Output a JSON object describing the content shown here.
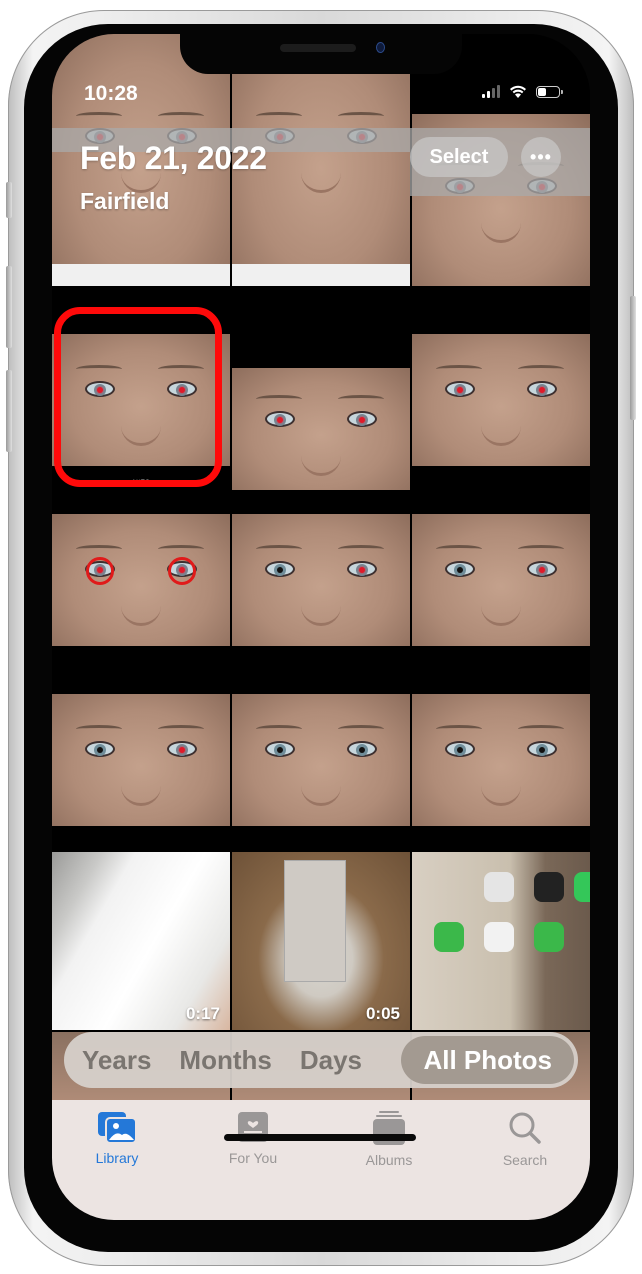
{
  "status_bar": {
    "time": "10:28",
    "signal_bars_active": 2,
    "signal_bars_total": 4,
    "wifi": "wifi-icon",
    "battery_level": 0.35
  },
  "header": {
    "date": "Feb 21, 2022",
    "location": "Fairfield",
    "select_label": "Select",
    "more_label": "•••"
  },
  "photos": [
    {
      "id": "top-1",
      "kind": "face",
      "red_eyes": [
        "left",
        "right"
      ]
    },
    {
      "id": "top-2",
      "kind": "face",
      "red_eyes": [
        "left",
        "right"
      ]
    },
    {
      "id": "top-3",
      "kind": "face",
      "red_eyes": [
        "left",
        "right"
      ]
    },
    {
      "id": "row2-1",
      "kind": "face",
      "red_eyes": [
        "left",
        "right"
      ],
      "badge": "AUTO",
      "highlighted": true
    },
    {
      "id": "row2-2",
      "kind": "face",
      "red_eyes": [
        "left",
        "right"
      ]
    },
    {
      "id": "row2-3",
      "kind": "face",
      "red_eyes": [
        "left",
        "right"
      ]
    },
    {
      "id": "row3-1",
      "kind": "face",
      "red_eyes": [
        "left",
        "right"
      ],
      "circled": true
    },
    {
      "id": "row3-2",
      "kind": "face",
      "red_eyes": [
        "right"
      ]
    },
    {
      "id": "row3-3",
      "kind": "face",
      "red_eyes": [
        "right"
      ]
    },
    {
      "id": "row4-1",
      "kind": "face",
      "red_eyes": [
        "right"
      ]
    },
    {
      "id": "row4-2",
      "kind": "face",
      "red_eyes": []
    },
    {
      "id": "row4-3",
      "kind": "face",
      "red_eyes": []
    },
    {
      "id": "row5-1",
      "kind": "video",
      "description": "white bucket lid",
      "duration": "0:17"
    },
    {
      "id": "row5-2",
      "kind": "video",
      "description": "cinder blocks on grass",
      "duration": "0:05"
    },
    {
      "id": "row5-3",
      "kind": "screenshot",
      "description": "home screen with apps"
    }
  ],
  "view_switcher": {
    "items": [
      {
        "label": "Years",
        "active": false
      },
      {
        "label": "Months",
        "active": false
      },
      {
        "label": "Days",
        "active": false
      },
      {
        "label": "All Photos",
        "active": true
      }
    ]
  },
  "tab_bar": {
    "items": [
      {
        "label": "Library",
        "icon": "library-icon",
        "active": true
      },
      {
        "label": "For You",
        "icon": "for-you-icon",
        "active": false
      },
      {
        "label": "Albums",
        "icon": "albums-icon",
        "active": false
      },
      {
        "label": "Search",
        "icon": "search-icon",
        "active": false
      }
    ]
  },
  "colors": {
    "accent": "#2478d8",
    "highlight_box": "#ff0a0a",
    "segment_active": "#a39a91",
    "tab_bar_bg": "#ece4e2"
  }
}
